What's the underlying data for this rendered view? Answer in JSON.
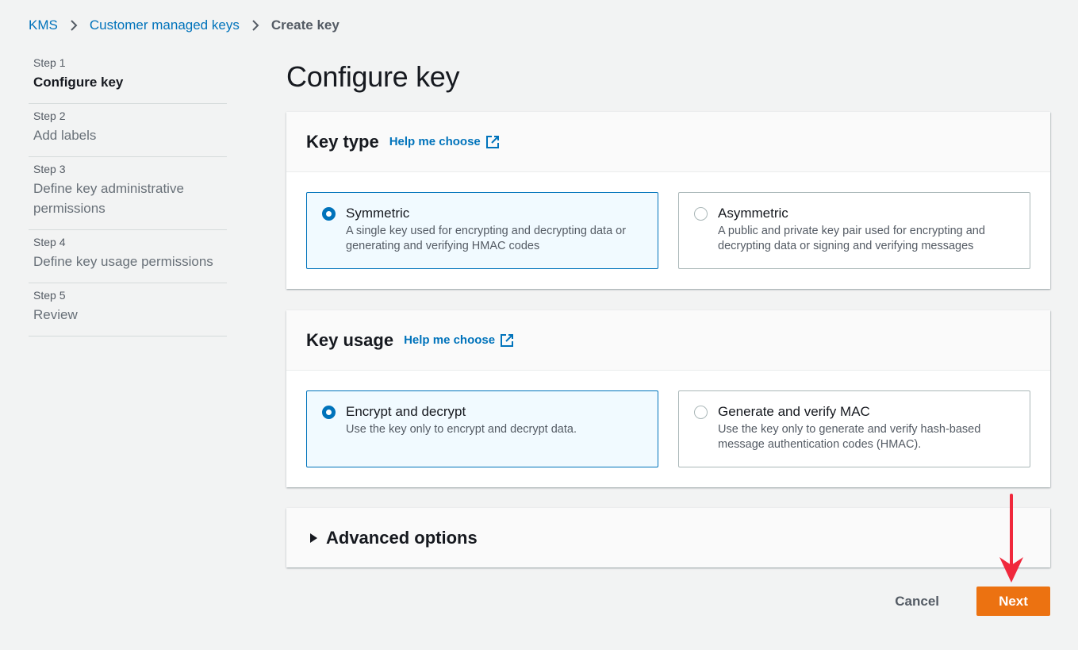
{
  "breadcrumb": {
    "items": [
      "KMS",
      "Customer managed keys"
    ],
    "current": "Create key"
  },
  "steps": [
    {
      "num": "Step 1",
      "title": "Configure key",
      "active": true
    },
    {
      "num": "Step 2",
      "title": "Add labels"
    },
    {
      "num": "Step 3",
      "title": "Define key administrative permissions"
    },
    {
      "num": "Step 4",
      "title": "Define key usage permissions"
    },
    {
      "num": "Step 5",
      "title": "Review"
    }
  ],
  "page_title": "Configure key",
  "key_type": {
    "heading": "Key type",
    "help": "Help me choose",
    "options": [
      {
        "title": "Symmetric",
        "desc": "A single key used for encrypting and decrypting data or generating and verifying HMAC codes",
        "selected": true
      },
      {
        "title": "Asymmetric",
        "desc": "A public and private key pair used for encrypting and decrypting data or signing and verifying messages",
        "selected": false
      }
    ]
  },
  "key_usage": {
    "heading": "Key usage",
    "help": "Help me choose",
    "options": [
      {
        "title": "Encrypt and decrypt",
        "desc": "Use the key only to encrypt and decrypt data.",
        "selected": true
      },
      {
        "title": "Generate and verify MAC",
        "desc": "Use the key only to generate and verify hash-based message authentication codes (HMAC).",
        "selected": false
      }
    ]
  },
  "advanced": {
    "title": "Advanced options"
  },
  "actions": {
    "cancel": "Cancel",
    "next": "Next"
  },
  "colors": {
    "accent": "#0073bb",
    "primary_button": "#ec7211",
    "arrow": "#f0283c"
  }
}
